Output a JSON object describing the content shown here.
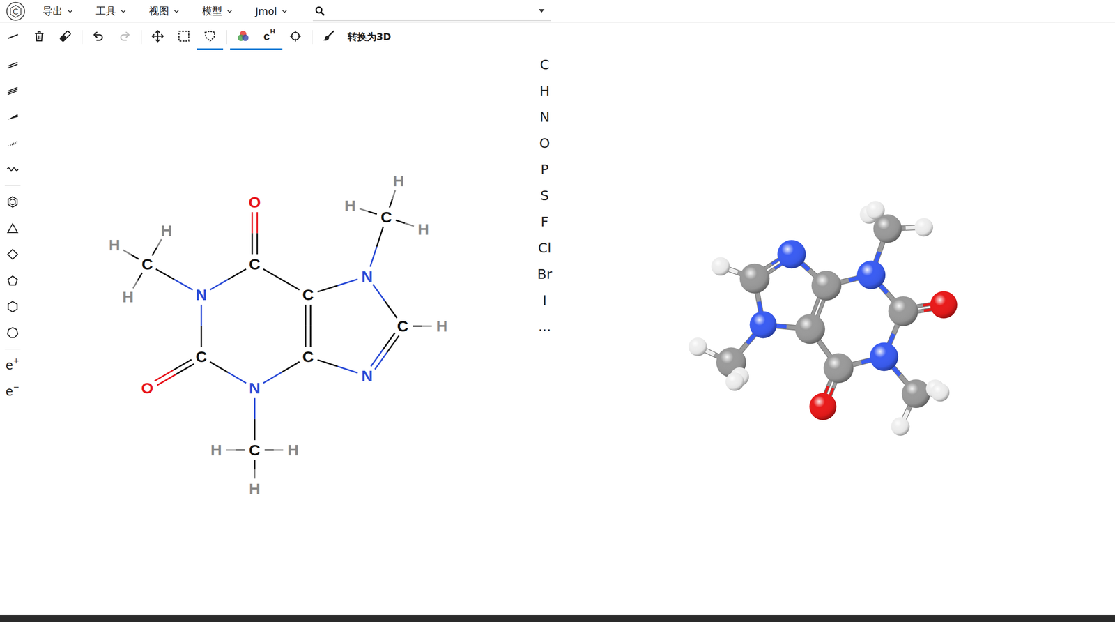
{
  "app": {
    "logo": "C"
  },
  "menus": [
    {
      "label": "导出"
    },
    {
      "label": "工具"
    },
    {
      "label": "视图"
    },
    {
      "label": "模型"
    },
    {
      "label": "Jmol"
    }
  ],
  "search": {
    "value": ""
  },
  "toolbar": [
    {
      "selected": false,
      "disabled": false
    },
    {
      "selected": false,
      "disabled": false
    },
    {
      "selected": false,
      "disabled": false
    },
    {
      "selected": false,
      "disabled": false
    },
    {
      "selected": false,
      "disabled": true
    },
    {
      "selected": false,
      "disabled": false
    },
    {
      "selected": false,
      "disabled": false
    },
    {
      "selected": true,
      "disabled": false
    },
    {
      "selected": true,
      "disabled": false
    },
    {
      "selected": true,
      "disabled": false,
      "text": "c",
      "sup": "H"
    },
    {
      "selected": false,
      "disabled": false
    },
    {
      "selected": false,
      "disabled": false
    }
  ],
  "convert_button": {
    "label": "转换为3D"
  },
  "left_tools": [
    {
      "selected": false
    },
    {
      "selected": false
    },
    {
      "selected": false
    },
    {
      "selected": false
    },
    {
      "selected": false
    },
    {
      "selected": false
    },
    {
      "selected": false
    },
    {
      "selected": false
    },
    {
      "selected": false
    },
    {
      "selected": false
    },
    {
      "selected": false
    },
    {
      "selected": false,
      "text": "e",
      "sup": "+"
    },
    {
      "selected": false,
      "text": "e",
      "sup": "−"
    }
  ],
  "elements": [
    {
      "symbol": "C"
    },
    {
      "symbol": "H"
    },
    {
      "symbol": "N"
    },
    {
      "symbol": "O"
    },
    {
      "symbol": "P"
    },
    {
      "symbol": "S"
    },
    {
      "symbol": "F"
    },
    {
      "symbol": "Cl"
    },
    {
      "symbol": "Br"
    },
    {
      "symbol": "I"
    },
    {
      "symbol": "..."
    }
  ],
  "molecule_2d": {
    "atoms": [
      {
        "label": "O",
        "color": "#e8141c"
      },
      {
        "label": "C",
        "color": "#111111"
      },
      {
        "label": "C",
        "color": "#111111"
      },
      {
        "label": "N",
        "color": "#2a4bd7"
      },
      {
        "label": "C",
        "color": "#111111"
      },
      {
        "label": "H",
        "color": "#888888"
      },
      {
        "label": "H",
        "color": "#888888"
      },
      {
        "label": "H",
        "color": "#888888"
      },
      {
        "label": "C",
        "color": "#111111"
      },
      {
        "label": "H",
        "color": "#888888"
      },
      {
        "label": "N",
        "color": "#2a4bd7"
      },
      {
        "label": "C",
        "color": "#111111"
      },
      {
        "label": "N",
        "color": "#2a4bd7"
      },
      {
        "label": "C",
        "color": "#111111"
      },
      {
        "label": "H",
        "color": "#888888"
      },
      {
        "label": "H",
        "color": "#888888"
      },
      {
        "label": "H",
        "color": "#888888"
      },
      {
        "label": "C",
        "color": "#111111"
      },
      {
        "label": "O",
        "color": "#e8141c"
      },
      {
        "label": "N",
        "color": "#2a4bd7"
      },
      {
        "label": "C",
        "color": "#111111"
      },
      {
        "label": "H",
        "color": "#888888"
      },
      {
        "label": "H",
        "color": "#888888"
      },
      {
        "label": "H",
        "color": "#888888"
      }
    ],
    "bonds": [
      {
        "from": 0,
        "to": 1,
        "order": 2
      },
      {
        "from": 1,
        "to": 2,
        "order": 1
      },
      {
        "from": 2,
        "to": 3,
        "order": 1
      },
      {
        "from": 3,
        "to": 4,
        "order": 1
      },
      {
        "from": 4,
        "to": 5,
        "order": 1
      },
      {
        "from": 4,
        "to": 6,
        "order": 1
      },
      {
        "from": 4,
        "to": 7,
        "order": 1
      },
      {
        "from": 3,
        "to": 8,
        "order": 1
      },
      {
        "from": 8,
        "to": 10,
        "order": 2
      },
      {
        "from": 8,
        "to": 9,
        "order": 1
      },
      {
        "from": 10,
        "to": 11,
        "order": 1
      },
      {
        "from": 11,
        "to": 2,
        "order": 2
      },
      {
        "from": 11,
        "to": 12,
        "order": 1
      },
      {
        "from": 12,
        "to": 13,
        "order": 1
      },
      {
        "from": 13,
        "to": 14,
        "order": 1
      },
      {
        "from": 13,
        "to": 15,
        "order": 1
      },
      {
        "from": 13,
        "to": 16,
        "order": 1
      },
      {
        "from": 12,
        "to": 17,
        "order": 1
      },
      {
        "from": 17,
        "to": 18,
        "order": 2
      },
      {
        "from": 17,
        "to": 19,
        "order": 1
      },
      {
        "from": 19,
        "to": 1,
        "order": 1
      },
      {
        "from": 19,
        "to": 20,
        "order": 1
      },
      {
        "from": 20,
        "to": 21,
        "order": 1
      },
      {
        "from": 20,
        "to": 22,
        "order": 1
      },
      {
        "from": 20,
        "to": 23,
        "order": 1
      }
    ]
  },
  "molecule_3d": {
    "atoms": [
      {
        "color": "#3a5cf2"
      },
      {
        "color": "#9a9a9a"
      },
      {
        "color": "#eeeeee"
      },
      {
        "color": "#3a5cf2"
      },
      {
        "color": "#9a9a9a"
      },
      {
        "color": "#eeeeee"
      },
      {
        "color": "#eeeeee"
      },
      {
        "color": "#eeeeee"
      },
      {
        "color": "#9a9a9a"
      },
      {
        "color": "#9a9a9a"
      },
      {
        "color": "#3a5cf2"
      },
      {
        "color": "#9a9a9a"
      },
      {
        "color": "#eeeeee"
      },
      {
        "color": "#eeeeee"
      },
      {
        "color": "#eeeeee"
      },
      {
        "color": "#9a9a9a"
      },
      {
        "color": "#e81a1a"
      },
      {
        "color": "#3a5cf2"
      },
      {
        "color": "#9a9a9a"
      },
      {
        "color": "#eeeeee"
      },
      {
        "color": "#eeeeee"
      },
      {
        "color": "#eeeeee"
      },
      {
        "color": "#9a9a9a"
      },
      {
        "color": "#e81a1a"
      }
    ],
    "bonds": [
      {
        "from": 0,
        "to": 1,
        "order": 2
      },
      {
        "from": 1,
        "to": 2,
        "order": 1
      },
      {
        "from": 1,
        "to": 3,
        "order": 1
      },
      {
        "from": 3,
        "to": 4,
        "order": 1
      },
      {
        "from": 4,
        "to": 5,
        "order": 1
      },
      {
        "from": 4,
        "to": 6,
        "order": 1
      },
      {
        "from": 4,
        "to": 7,
        "order": 1
      },
      {
        "from": 3,
        "to": 8,
        "order": 1
      },
      {
        "from": 8,
        "to": 9,
        "order": 2
      },
      {
        "from": 9,
        "to": 0,
        "order": 1
      },
      {
        "from": 9,
        "to": 10,
        "order": 1
      },
      {
        "from": 10,
        "to": 11,
        "order": 1
      },
      {
        "from": 11,
        "to": 12,
        "order": 1
      },
      {
        "from": 11,
        "to": 13,
        "order": 1
      },
      {
        "from": 11,
        "to": 14,
        "order": 1
      },
      {
        "from": 10,
        "to": 15,
        "order": 1
      },
      {
        "from": 15,
        "to": 16,
        "order": 2
      },
      {
        "from": 15,
        "to": 17,
        "order": 1
      },
      {
        "from": 17,
        "to": 18,
        "order": 1
      },
      {
        "from": 18,
        "to": 19,
        "order": 1
      },
      {
        "from": 18,
        "to": 20,
        "order": 1
      },
      {
        "from": 18,
        "to": 21,
        "order": 1
      },
      {
        "from": 17,
        "to": 22,
        "order": 1
      },
      {
        "from": 22,
        "to": 23,
        "order": 2
      },
      {
        "from": 22,
        "to": 8,
        "order": 1
      }
    ]
  }
}
